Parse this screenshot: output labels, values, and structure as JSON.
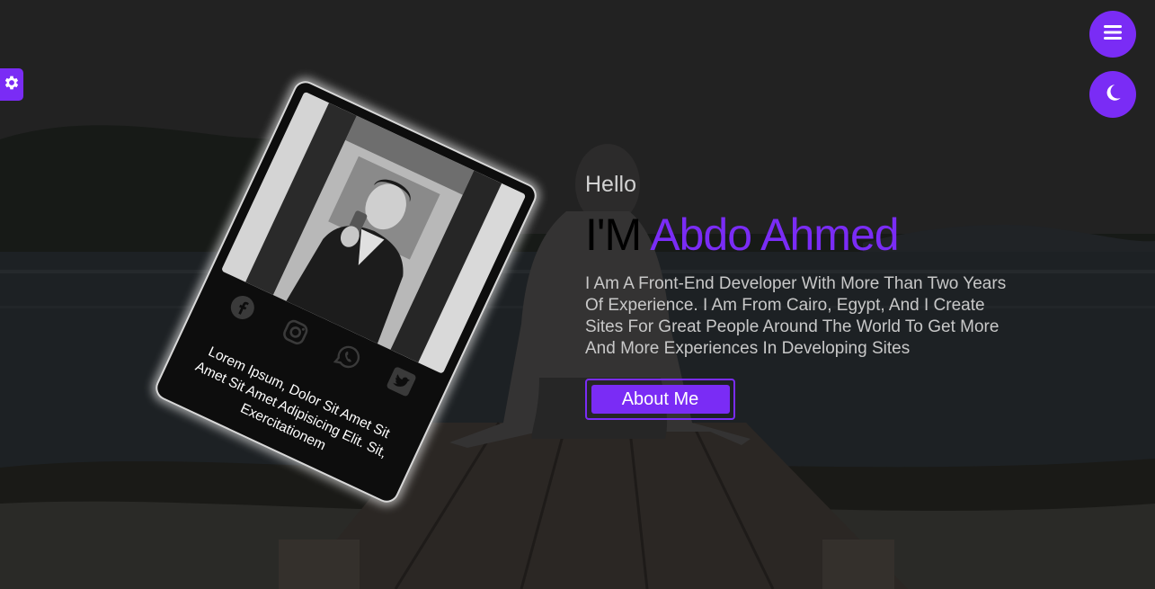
{
  "hero": {
    "greeting": "Hello",
    "prefix": "I'M",
    "name": "Abdo Ahmed",
    "description": "I Am A Front-End Developer With More Than Two Years Of Experience. I Am From Cairo, Egypt, And I Create Sites For Great People Around The World To Get More And More Experiences In Developing Sites",
    "about_label": "About Me"
  },
  "card": {
    "text": "Lorem Ipsum, Dolor Sit Amet Sit Amet Sit Amet Adipisicing Elit. Sit, Exercitationem",
    "social_icons": [
      "facebook-icon",
      "instagram-icon",
      "whatsapp-icon",
      "twitter-icon"
    ]
  },
  "controls": {
    "settings_icon": "gear-icon",
    "menu_icon": "hamburger-icon",
    "theme_icon": "moon-icon"
  },
  "colors": {
    "accent": "#7a2cf5",
    "background": "#1c1c1c",
    "text_light": "#c8c8c8"
  }
}
